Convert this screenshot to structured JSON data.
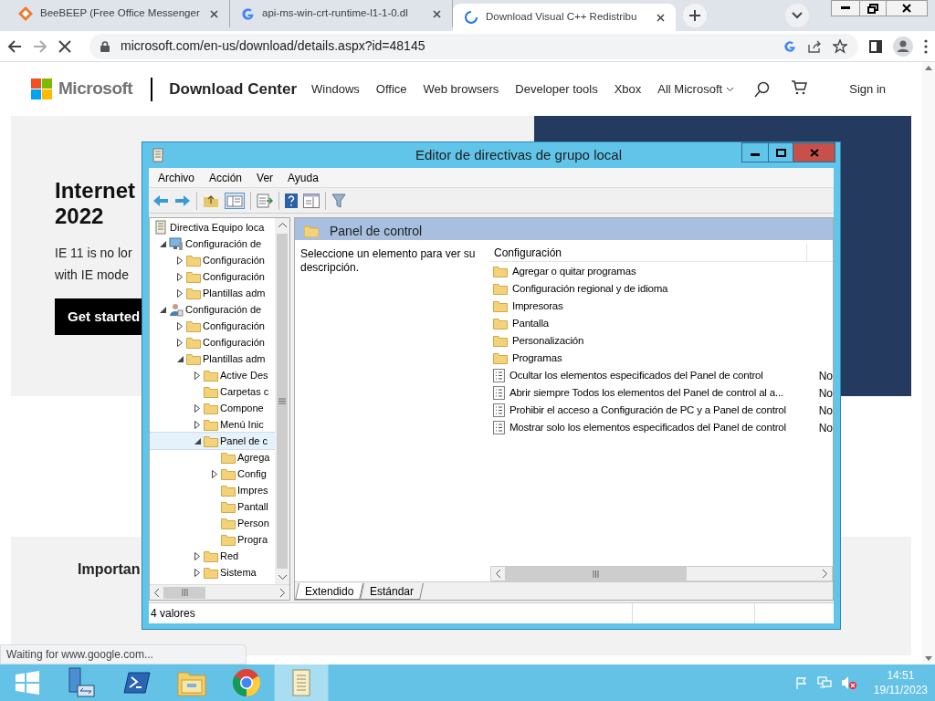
{
  "browser": {
    "tabs": [
      {
        "title": "BeeBEEP (Free Office Messenger",
        "selected": false,
        "kind": "beebeep"
      },
      {
        "title": "api-ms-win-crt-runtime-l1-1-0.dl",
        "selected": false,
        "kind": "google"
      },
      {
        "title": "Download Visual C++ Redistribu",
        "selected": true,
        "kind": "loading"
      }
    ],
    "url": "microsoft.com/en-us/download/details.aspx?id=48145",
    "status": "Waiting for www.google.com..."
  },
  "site": {
    "brand": "Microsoft",
    "section": "Download Center",
    "nav": [
      "Windows",
      "Office",
      "Web browsers",
      "Developer tools",
      "Xbox",
      "All Microsoft"
    ],
    "sign_in": "Sign in",
    "hero": {
      "title_lines": [
        "Internet",
        "2022"
      ],
      "text_lines": [
        "IE 11 is no lor",
        "with IE mode"
      ],
      "button": "Get started"
    },
    "section_title": "Importan"
  },
  "mmc": {
    "title": "Editor de directivas de grupo local",
    "menu": [
      "Archivo",
      "Acción",
      "Ver",
      "Ayuda"
    ],
    "tree": [
      {
        "label": "Directiva Equipo loca",
        "kind": "policy",
        "selected": false,
        "children": [
          {
            "label": "Configuración de",
            "kind": "computer",
            "expanded": true,
            "selected": false,
            "children": [
              {
                "label": "Configuración",
                "kind": "folder",
                "expanded": false,
                "selected": false
              },
              {
                "label": "Configuración",
                "kind": "folder",
                "expanded": false,
                "selected": false
              },
              {
                "label": "Plantillas adm",
                "kind": "folder",
                "expanded": false,
                "selected": false
              }
            ]
          },
          {
            "label": "Configuración de",
            "kind": "user",
            "expanded": true,
            "selected": false,
            "children": [
              {
                "label": "Configuración",
                "kind": "folder",
                "expanded": false,
                "selected": false
              },
              {
                "label": "Configuración",
                "kind": "folder",
                "expanded": false,
                "selected": false
              },
              {
                "label": "Plantillas adm",
                "kind": "folder",
                "expanded": true,
                "selected": false,
                "children": [
                  {
                    "label": "Active Des",
                    "kind": "folder",
                    "expanded": false,
                    "selected": false
                  },
                  {
                    "label": "Carpetas c",
                    "kind": "folder",
                    "selected": false
                  },
                  {
                    "label": "Compone",
                    "kind": "folder",
                    "expanded": false,
                    "selected": false
                  },
                  {
                    "label": "Menú Inic",
                    "kind": "folder",
                    "expanded": false,
                    "selected": false
                  },
                  {
                    "label": "Panel de c",
                    "kind": "folder",
                    "expanded": true,
                    "selected": true,
                    "children": [
                      {
                        "label": "Agrega",
                        "kind": "folder",
                        "selected": false
                      },
                      {
                        "label": "Config",
                        "kind": "folder",
                        "expanded": false,
                        "selected": false
                      },
                      {
                        "label": "Impres",
                        "kind": "folder",
                        "selected": false
                      },
                      {
                        "label": "Pantall",
                        "kind": "folder",
                        "selected": false
                      },
                      {
                        "label": "Person",
                        "kind": "folder",
                        "selected": false
                      },
                      {
                        "label": "Progra",
                        "kind": "folder",
                        "selected": false
                      }
                    ]
                  },
                  {
                    "label": "Red",
                    "kind": "folder",
                    "expanded": false,
                    "selected": false
                  },
                  {
                    "label": "Sistema",
                    "kind": "folder",
                    "expanded": false,
                    "selected": false
                  }
                ]
              }
            ]
          }
        ]
      }
    ],
    "pane_title": "Panel de control",
    "description": "Seleccione un elemento para ver su descripción.",
    "columns": [
      "Configuración"
    ],
    "rows": [
      {
        "kind": "folder",
        "name": "Agregar o quitar programas"
      },
      {
        "kind": "folder",
        "name": "Configuración regional y de idioma"
      },
      {
        "kind": "folder",
        "name": "Impresoras"
      },
      {
        "kind": "folder",
        "name": "Pantalla"
      },
      {
        "kind": "folder",
        "name": "Personalización"
      },
      {
        "kind": "folder",
        "name": "Programas"
      },
      {
        "kind": "setting",
        "name": "Ocultar los elementos especificados del Panel de control",
        "column_2": "No"
      },
      {
        "kind": "setting",
        "name": "Abrir siempre Todos los elementos del Panel de control al a...",
        "column_2": "No"
      },
      {
        "kind": "setting",
        "name": "Prohibir el acceso a Configuración de PC y a Panel de control",
        "column_2": "No"
      },
      {
        "kind": "setting",
        "name": "Mostrar solo los elementos especificados del Panel de control",
        "column_2": "No"
      }
    ],
    "view_tabs": [
      {
        "label": "Extendido",
        "selected": true
      },
      {
        "label": "Estándar",
        "selected": false
      }
    ],
    "status": "4 valores"
  },
  "taskbar": {
    "apps": [
      {
        "kind": "start",
        "active": false
      },
      {
        "kind": "server",
        "active": false
      },
      {
        "kind": "powershell",
        "active": false
      },
      {
        "kind": "explorer",
        "active": false
      },
      {
        "kind": "chrome",
        "active": false
      },
      {
        "kind": "policy",
        "active": true
      }
    ],
    "time": "14:51",
    "date": "19/11/2023"
  }
}
